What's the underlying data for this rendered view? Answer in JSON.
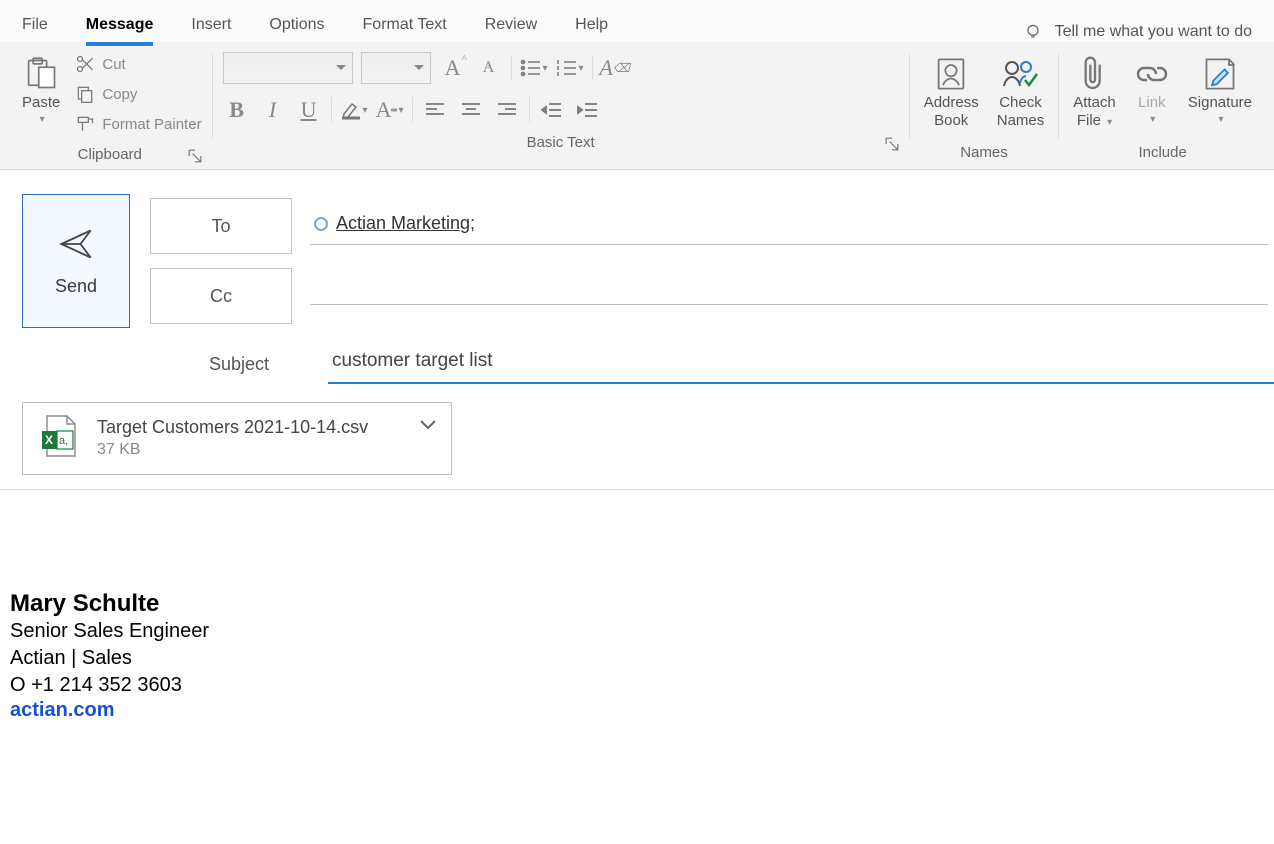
{
  "tabs": {
    "file": "File",
    "message": "Message",
    "insert": "Insert",
    "options": "Options",
    "format_text": "Format Text",
    "review": "Review",
    "help": "Help",
    "tell_me": "Tell me what you want to do"
  },
  "ribbon": {
    "clipboard": {
      "label": "Clipboard",
      "paste": "Paste",
      "cut": "Cut",
      "copy": "Copy",
      "format_painter": "Format Painter"
    },
    "basic_text": {
      "label": "Basic Text"
    },
    "names": {
      "label": "Names",
      "address_book": "Address\nBook",
      "check_names": "Check\nNames"
    },
    "include": {
      "label": "Include",
      "attach_file": "Attach\nFile",
      "link": "Link",
      "signature": "Signature"
    }
  },
  "compose": {
    "send": "Send",
    "to_label": "To",
    "cc_label": "Cc",
    "to_value": "Actian Marketing;",
    "cc_value": "",
    "subject_label": "Subject",
    "subject_value": "customer target list"
  },
  "attachment": {
    "name": "Target Customers 2021-10-14.csv",
    "size": "37 KB"
  },
  "signature": {
    "name": "Mary Schulte",
    "title": "Senior Sales Engineer",
    "org": "Actian | Sales",
    "phone": "O +1 214 352 3603",
    "link": "actian.com"
  }
}
